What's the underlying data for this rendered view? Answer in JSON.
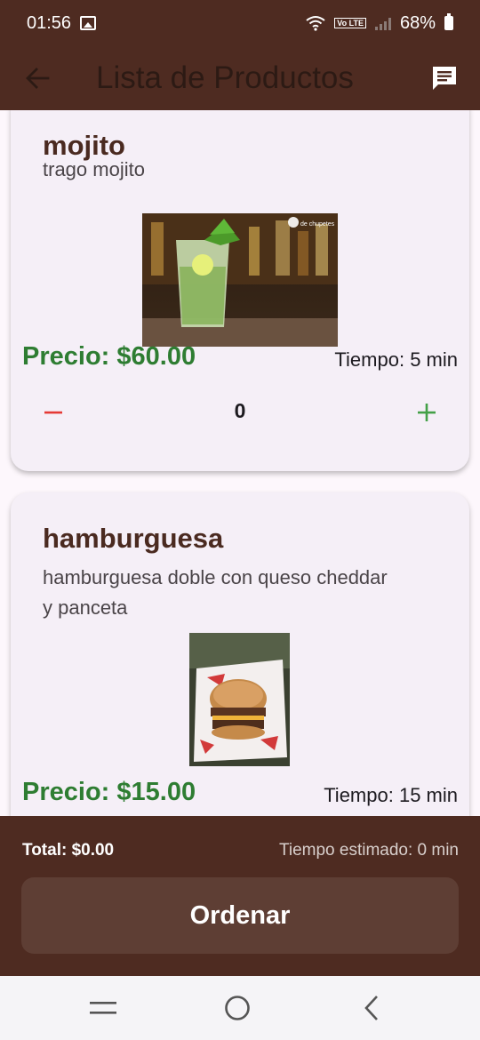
{
  "status_bar": {
    "time": "01:56",
    "battery": "68%",
    "volte": "Vo LTE"
  },
  "app_bar": {
    "title": "Lista de Productos",
    "back_icon": "arrow-back-icon",
    "chat_icon": "chat-icon"
  },
  "products": [
    {
      "name": "mojito",
      "description": "trago mojito",
      "image_watermark": "de chupetes",
      "price": "Precio: $60.00",
      "time": "Tiempo: 5 min",
      "quantity": "0"
    },
    {
      "name": "hamburguesa",
      "description": "hamburguesa doble con queso cheddar y panceta",
      "price": "Precio: $15.00",
      "time": "Tiempo: 15 min"
    }
  ],
  "bottom_bar": {
    "total": "Total: $0.00",
    "estimated_time": "Tiempo estimado: 0 min",
    "order_label": "Ordenar"
  },
  "colors": {
    "brand": "#4e2b21",
    "price_green": "#2e7d32",
    "minus_red": "#e53935",
    "plus_green": "#43a047"
  }
}
